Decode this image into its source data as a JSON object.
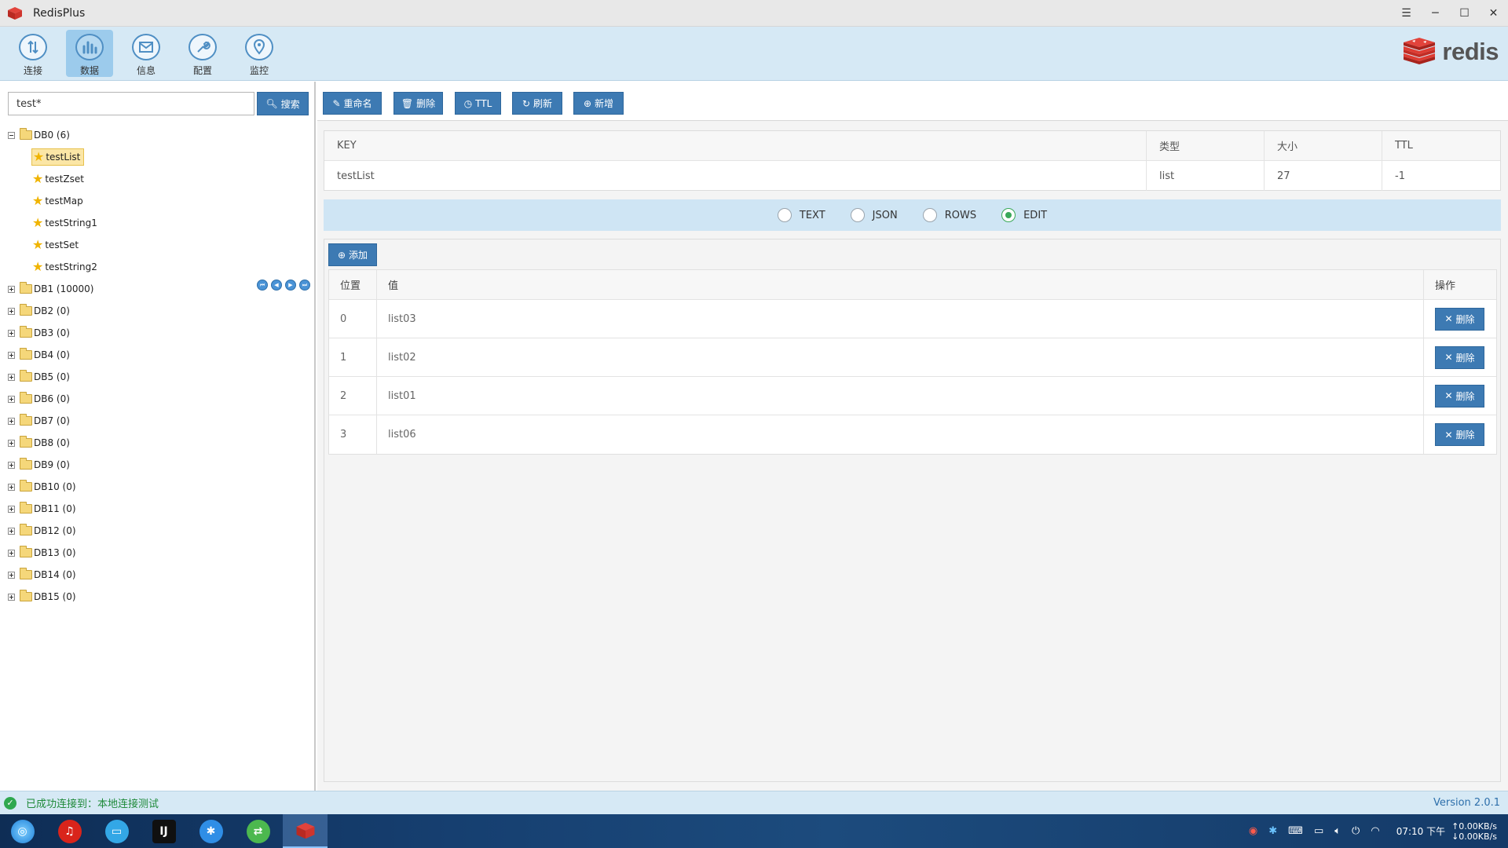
{
  "window": {
    "title": "RedisPlus"
  },
  "toolbar": {
    "items": [
      {
        "label": "连接",
        "icon": "connect-icon"
      },
      {
        "label": "数据",
        "icon": "data-chart-icon",
        "active": true
      },
      {
        "label": "信息",
        "icon": "mail-info-icon"
      },
      {
        "label": "配置",
        "icon": "wrench-config-icon"
      },
      {
        "label": "监控",
        "icon": "monitor-pin-icon"
      }
    ],
    "logo_text": "redis"
  },
  "search": {
    "value": "test*",
    "button_label": "搜索"
  },
  "tree": {
    "db0": {
      "label": "DB0 (6)",
      "keys": [
        "testList",
        "testZset",
        "testMap",
        "testString1",
        "testSet",
        "testString2"
      ],
      "selected": "testList"
    },
    "dbs": [
      "DB1 (10000)",
      "DB2 (0)",
      "DB3 (0)",
      "DB4 (0)",
      "DB5 (0)",
      "DB6 (0)",
      "DB7 (0)",
      "DB8 (0)",
      "DB9 (0)",
      "DB10 (0)",
      "DB11 (0)",
      "DB12 (0)",
      "DB13 (0)",
      "DB14 (0)",
      "DB15 (0)"
    ]
  },
  "actions": {
    "rename": "重命名",
    "delete": "删除",
    "ttl": "TTL",
    "refresh": "刷新",
    "new": "新增"
  },
  "key_info": {
    "headers": {
      "key": "KEY",
      "type": "类型",
      "size": "大小",
      "ttl": "TTL"
    },
    "row": {
      "key": "testList",
      "type": "list",
      "size": "27",
      "ttl": "-1"
    }
  },
  "view_modes": {
    "options": [
      "TEXT",
      "JSON",
      "ROWS",
      "EDIT"
    ],
    "selected": "EDIT"
  },
  "edit": {
    "add_label": "添加",
    "headers": {
      "position": "位置",
      "value": "值",
      "ops": "操作"
    },
    "rows": [
      {
        "position": "0",
        "value": "list03"
      },
      {
        "position": "1",
        "value": "list02"
      },
      {
        "position": "2",
        "value": "list01"
      },
      {
        "position": "3",
        "value": "list06"
      }
    ],
    "delete_label": "删除"
  },
  "status": {
    "text": "已成功连接到：本地连接测试",
    "version": "Version 2.0.1"
  },
  "taskbar": {
    "clock": "07:10 下午",
    "net_up": "↑0.00KB/s",
    "net_down": "↓0.00KB/s",
    "accent": "#1c4b7d"
  },
  "colors": {
    "accent": "#3d7ab3",
    "toolbar_bg": "#d6e9f5",
    "status_ok": "#2fa84f",
    "radio_on": "#3aa859"
  }
}
